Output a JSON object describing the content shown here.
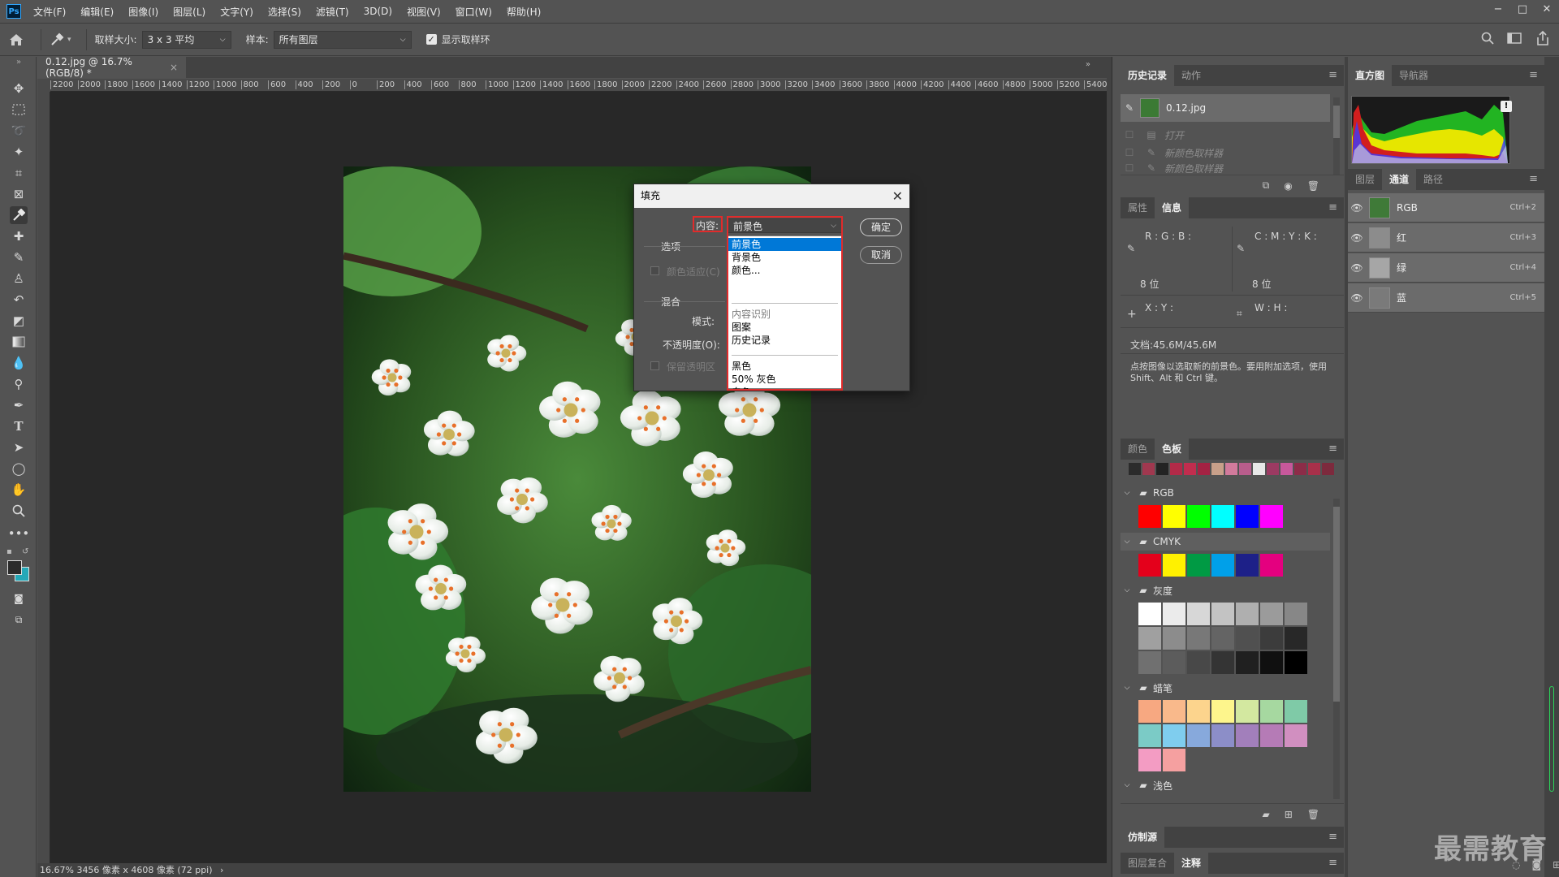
{
  "menubar": {
    "app_logo": "Ps",
    "items": [
      "文件(F)",
      "编辑(E)",
      "图像(I)",
      "图层(L)",
      "文字(Y)",
      "选择(S)",
      "滤镜(T)",
      "3D(D)",
      "视图(V)",
      "窗口(W)",
      "帮助(H)"
    ]
  },
  "window": {
    "minimize": "−",
    "maximize": "□",
    "close": "✕"
  },
  "options": {
    "sample_size_label": "取样大小:",
    "sample_size_value": "3 x 3 平均",
    "sample_label": "样本:",
    "sample_value": "所有图层",
    "show_ring_label": "显示取样环",
    "show_ring_checked": true
  },
  "document": {
    "tab_title": "0.12.jpg @ 16.7%(RGB/8) *",
    "tab_close": "×",
    "ruler_labels": [
      "2200",
      "2000",
      "1800",
      "1600",
      "1400",
      "1200",
      "1000",
      "800",
      "600",
      "400",
      "200",
      "0",
      "200",
      "400",
      "600",
      "800",
      "1000",
      "1200",
      "1400",
      "1600",
      "1800",
      "2000",
      "2200",
      "2400",
      "2600",
      "2800",
      "3000",
      "3200",
      "3400",
      "3600",
      "3800",
      "4000",
      "4200",
      "4400",
      "4600",
      "4800",
      "5000",
      "5200",
      "5400"
    ],
    "status": "16.67%  3456 像素 x 4608 像素 (72 ppi)",
    "status_arrow": "›"
  },
  "fill_dialog": {
    "title": "填充",
    "close": "✕",
    "content_label": "内容:",
    "content_value": "前景色",
    "options_section": "选项",
    "color_adapt_label": "颜色适应(C)",
    "blend_section": "混合",
    "mode_label": "模式:",
    "opacity_label": "不透明度(O):",
    "preserve_label": "保留透明区",
    "ok_button": "确定",
    "cancel_button": "取消",
    "dropdown_options": {
      "fg": "前景色",
      "bg": "背景色",
      "color": "颜色...",
      "content_aware": "内容识别",
      "pattern": "图案",
      "history": "历史记录",
      "black": "黑色",
      "gray50": "50% 灰色",
      "white": "白色"
    }
  },
  "history_panel": {
    "tabs": [
      "历史记录",
      "动作"
    ],
    "snapshot": "0.12.jpg",
    "items": [
      "打开",
      "新颜色取样器",
      "新颜色取样器"
    ]
  },
  "histogram_panel": {
    "tabs": [
      "直方图",
      "导航器"
    ],
    "warning": "!"
  },
  "channels_panel": {
    "tabs": [
      "图层",
      "通道",
      "路径"
    ],
    "channels": [
      {
        "name": "RGB",
        "shortcut": "Ctrl+2"
      },
      {
        "name": "红",
        "shortcut": "Ctrl+3"
      },
      {
        "name": "绿",
        "shortcut": "Ctrl+4"
      },
      {
        "name": "蓝",
        "shortcut": "Ctrl+5"
      }
    ]
  },
  "info_panel": {
    "tabs": [
      "属性",
      "信息"
    ],
    "rgb_lines": "R :\nG :\nB :",
    "cmyk_lines": "C :\nM :\nY :\nK :",
    "bits_left": "8 位",
    "bits_right": "8 位",
    "xy": "X :\nY :",
    "wh": "W :\nH :",
    "doc_size": "文档:45.6M/45.6M",
    "hint": "点按图像以选取新的前景色。要用附加选项，使用 Shift、Alt 和 Ctrl 键。"
  },
  "swatches_panel": {
    "tabs": [
      "颜色",
      "色板"
    ],
    "recent_colors": [
      "#2b2b2b",
      "#a0384f",
      "#232323",
      "#b22a48",
      "#c12d4e",
      "#a42243",
      "#c8a08a",
      "#d27a9c",
      "#b85d8c",
      "#e8e8e8",
      "#9c3a62",
      "#c7589b",
      "#8c2c48",
      "#a8304a",
      "#7d2a3d"
    ],
    "groups": [
      {
        "name": "RGB",
        "colors": [
          "#ff0000",
          "#ffff00",
          "#00ff00",
          "#00ffff",
          "#0000ff",
          "#ff00ff"
        ]
      },
      {
        "name": "CMYK",
        "colors": [
          "#e4001b",
          "#fff100",
          "#009a44",
          "#00a0e9",
          "#1d2088",
          "#e4007f"
        ]
      },
      {
        "name": "灰度",
        "colors": [
          "#ffffff",
          "#ebebeb",
          "#d7d7d7",
          "#c3c3c3",
          "#afafaf",
          "#9b9b9b",
          "#878787",
          "#a0a0a0",
          "#8c8c8c",
          "#787878",
          "#646464",
          "#505050",
          "#3c3c3c",
          "#282828",
          "#707070",
          "#5c5c5c",
          "#484848",
          "#343434",
          "#202020",
          "#101010",
          "#000000"
        ]
      },
      {
        "name": "蜡笔",
        "colors": [
          "#f7a881",
          "#f9b98b",
          "#fcd48d",
          "#fdf58c",
          "#d3e8a0",
          "#a6d8a0",
          "#7fcaa7",
          "#7bcbc6",
          "#7fcdee",
          "#87a9dc",
          "#8c8ec8",
          "#a27fbb",
          "#b57bb6",
          "#d18fc0",
          "#f39cc3",
          "#f5a0a0"
        ]
      },
      {
        "name": "浅色",
        "colors": []
      }
    ]
  },
  "clone_panel": {
    "tab": "仿制源"
  },
  "bottom_panel": {
    "tabs": [
      "图层复合",
      "注释"
    ]
  },
  "watermark": "最需教育",
  "colors": {
    "foreground": "#2b2b2b",
    "background": "#23a8b8",
    "dialog_highlight": "#0078d7",
    "annotation_red": "#e12b2b"
  }
}
